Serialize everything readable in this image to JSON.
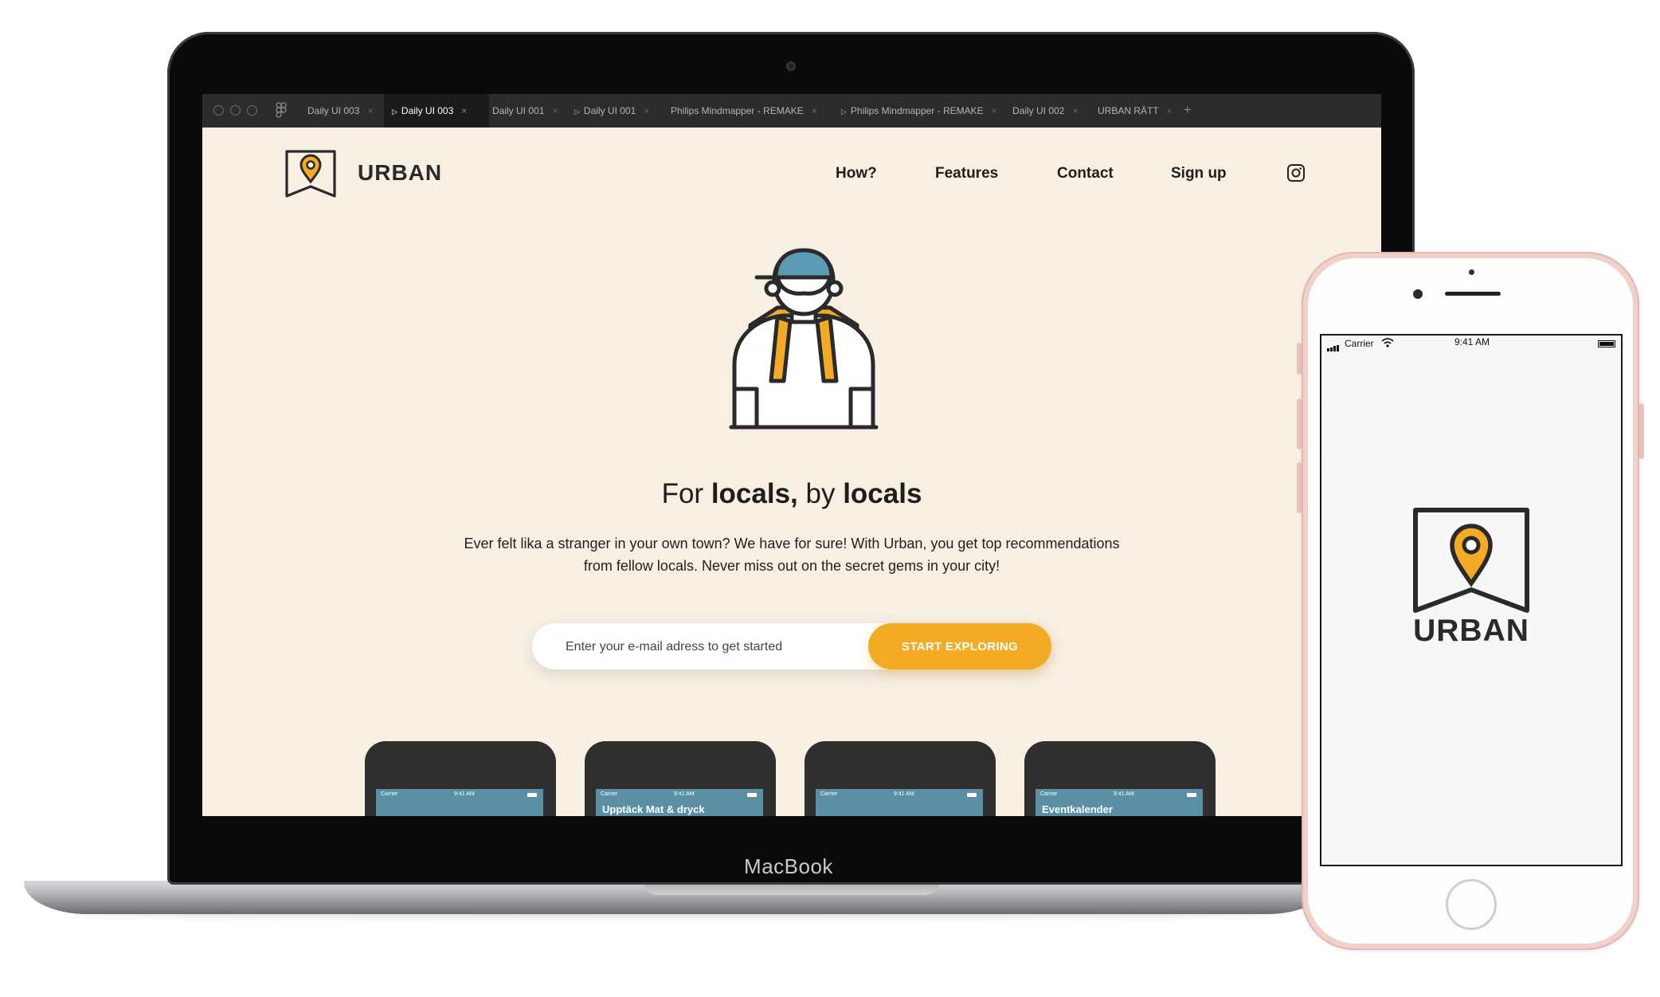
{
  "device_label": "MacBook",
  "browser": {
    "tabs": [
      {
        "label": "Daily UI 003",
        "active": false,
        "prototype": false
      },
      {
        "label": "Daily UI 003",
        "active": true,
        "prototype": true
      },
      {
        "label": "Daily UI 001",
        "active": false,
        "prototype": false
      },
      {
        "label": "Daily UI 001",
        "active": false,
        "prototype": true
      },
      {
        "label": "Philips Mindmapper - REMAKE",
        "active": false,
        "prototype": false
      },
      {
        "label": "Philips Mindmapper - REMAKE",
        "active": false,
        "prototype": true
      },
      {
        "label": "Daily UI 002",
        "active": false,
        "prototype": false
      },
      {
        "label": "URBAN RÄTT",
        "active": false,
        "prototype": false
      }
    ],
    "new_tab": "+"
  },
  "page": {
    "brand": "URBAN",
    "nav": [
      "How?",
      "Features",
      "Contact",
      "Sign up"
    ],
    "social_icon": "instagram-icon",
    "headline": {
      "w1": "For ",
      "w2": "locals,",
      "w3": " by ",
      "w4": "locals"
    },
    "lede_line1": "Ever felt lika a stranger in your own town? We have for sure! With Urban, you get top recommendations",
    "lede_line2": "from fellow locals. Never miss out on the secret gems in your city!",
    "email_placeholder": "Enter your e-mail adress to get started",
    "cta_label": "START EXPLORING",
    "mini_phones": [
      {
        "carrier": "Carrier",
        "time": "9:41 AM",
        "title": ""
      },
      {
        "carrier": "Carrier",
        "time": "9:41 AM",
        "title": "Upptäck Mat & dryck"
      },
      {
        "carrier": "Carrier",
        "time": "9:41 AM",
        "title": ""
      },
      {
        "carrier": "Carrier",
        "time": "9:41 AM",
        "title": "Eventkalender"
      }
    ]
  },
  "phone": {
    "carrier": "Carrier",
    "time": "9:41 AM",
    "brand": "URBAN"
  },
  "colors": {
    "accent": "#f3ab25",
    "page_bg": "#f7efe2",
    "ink": "#2a2a2a",
    "teal": "#5b8fa3",
    "phone_rose": "#f0d2cb"
  }
}
